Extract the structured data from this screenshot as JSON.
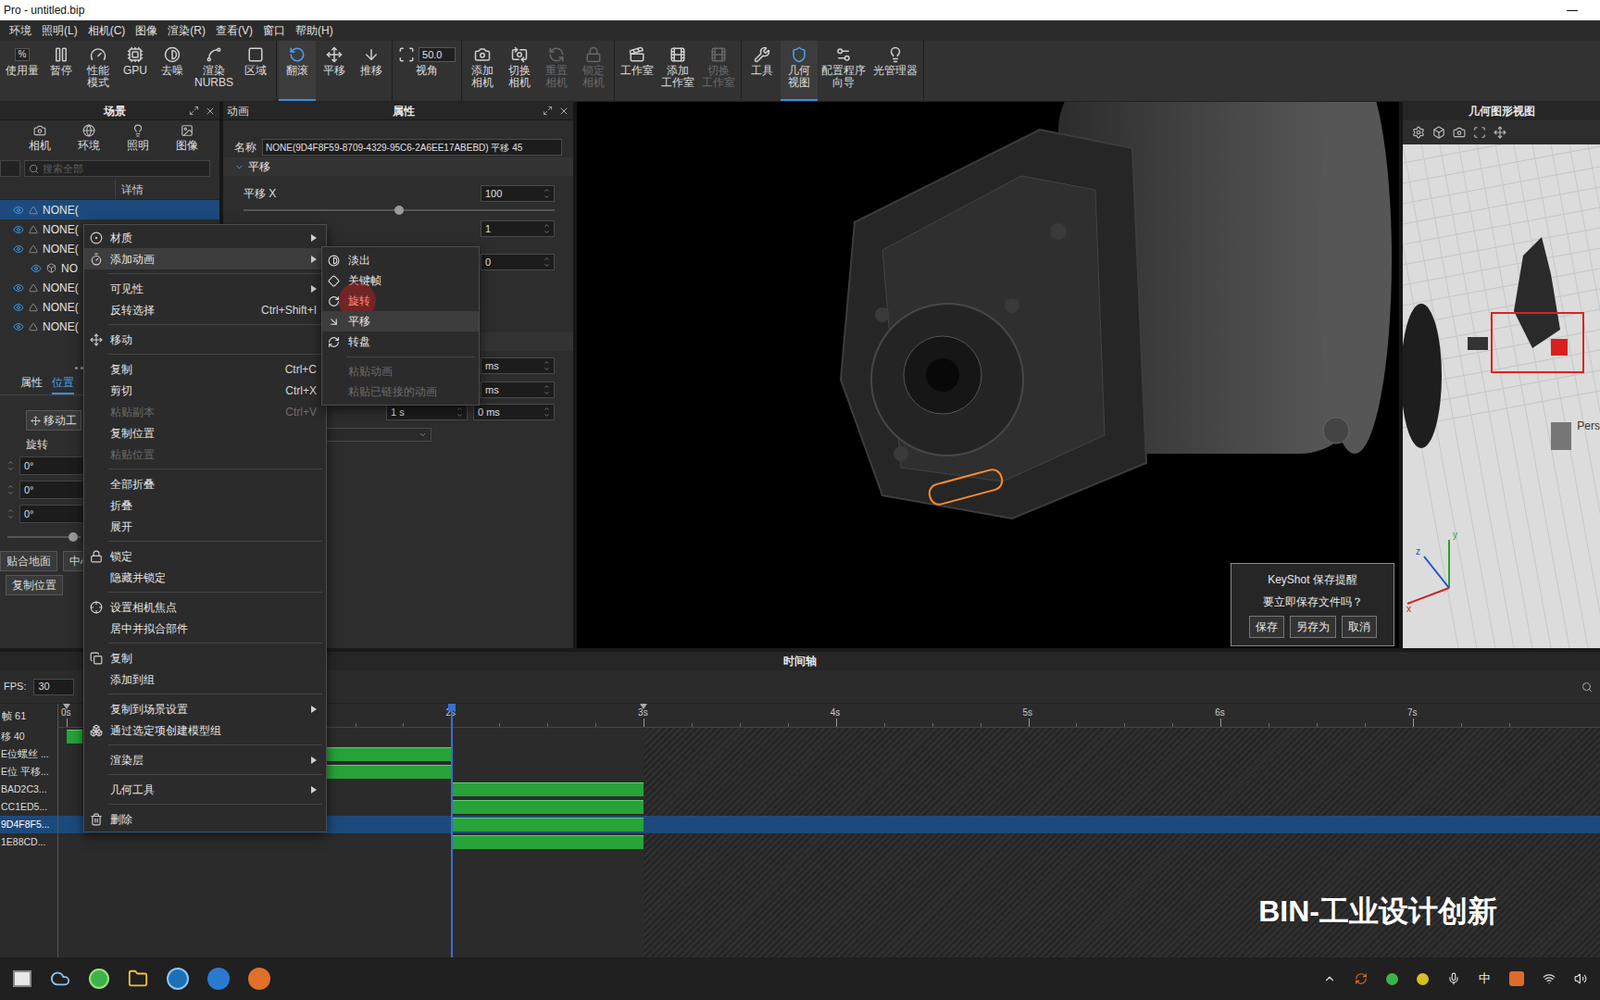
{
  "window": {
    "title": "Pro  - untitled.bip",
    "minimize": "—"
  },
  "menu_bar": [
    "环境",
    "照明(L)",
    "相机(C)",
    "图像",
    "渲染(R)",
    "查看(V)",
    "窗口",
    "帮助(H)"
  ],
  "toolbar": [
    [
      {
        "lines": [
          "使用量"
        ],
        "badge": "%",
        "selected": false,
        "disabled": false
      },
      {
        "lines": [
          "暂停"
        ],
        "selected": false,
        "disabled": false
      },
      {
        "lines": [
          "性能",
          "模式"
        ],
        "selected": false,
        "disabled": false
      },
      {
        "lines": [
          "GPU"
        ],
        "selected": false,
        "disabled": false
      },
      {
        "lines": [
          "去噪"
        ],
        "selected": false,
        "disabled": false
      },
      {
        "lines": [
          "渲染",
          "NURBS"
        ],
        "selected": false,
        "disabled": false
      },
      {
        "lines": [
          "区域"
        ],
        "selected": false,
        "disabled": false
      }
    ],
    [
      {
        "lines": [
          "翻滚"
        ],
        "selected": true,
        "disabled": false
      },
      {
        "lines": [
          "平移"
        ],
        "selected": false,
        "disabled": false
      },
      {
        "lines": [
          "推移"
        ],
        "selected": false,
        "disabled": false
      }
    ],
    [
      {
        "lines": [
          "视角"
        ],
        "field": "50.0",
        "selected": false,
        "disabled": false
      }
    ],
    [
      {
        "lines": [
          "添加",
          "相机"
        ],
        "selected": false,
        "disabled": false
      },
      {
        "lines": [
          "切换",
          "相机"
        ],
        "selected": false,
        "disabled": false
      },
      {
        "lines": [
          "重置",
          "相机"
        ],
        "selected": false,
        "disabled": true
      },
      {
        "lines": [
          "锁定",
          "相机"
        ],
        "selected": false,
        "disabled": true
      }
    ],
    [
      {
        "lines": [
          "工作室"
        ],
        "selected": false,
        "disabled": false
      },
      {
        "lines": [
          "添加",
          "工作室"
        ],
        "selected": false,
        "disabled": false
      },
      {
        "lines": [
          "切换",
          "工作室"
        ],
        "selected": false,
        "disabled": true
      }
    ],
    [
      {
        "lines": [
          "工具"
        ],
        "selected": false,
        "disabled": false
      },
      {
        "lines": [
          "几何",
          "视图"
        ],
        "selected": true,
        "disabled": false
      },
      {
        "lines": [
          "配置程序",
          "向导"
        ],
        "selected": false,
        "disabled": false
      },
      {
        "lines": [
          "光管理器"
        ],
        "selected": false,
        "disabled": false
      }
    ]
  ],
  "scene_panel": {
    "title": "场景",
    "tabs": [
      {
        "label": "相机"
      },
      {
        "label": "环境"
      },
      {
        "label": "照明"
      },
      {
        "label": "图像"
      }
    ],
    "search_placeholder": "搜索全部",
    "column": "详情",
    "tree": [
      {
        "label": "NONE(",
        "selected": true,
        "child": false
      },
      {
        "label": "NONE(",
        "selected": false,
        "child": false
      },
      {
        "label": "NONE(",
        "selected": false,
        "child": false
      },
      {
        "label": "NO",
        "selected": false,
        "child": true
      },
      {
        "label": "NONE(",
        "selected": false,
        "child": false
      },
      {
        "label": "NONE(",
        "selected": false,
        "child": false
      },
      {
        "label": "NONE(",
        "selected": false,
        "child": false
      }
    ],
    "bottom_tabs": [
      {
        "label": "属性",
        "selected": false
      },
      {
        "label": "位置",
        "selected": true
      }
    ],
    "move_tool": "移动工",
    "rotate_label": "旋转",
    "rotation": [
      "0°",
      "0°",
      "0°"
    ],
    "slider_level": 0.9,
    "buttons_row1": [
      "贴合地面",
      "中心"
    ],
    "buttons_row2": [
      "复制位置"
    ]
  },
  "properties_panel": {
    "tab_left": "动画",
    "title": "属性",
    "name_label": "名称",
    "name_value": "NONE(9D4F8F59-8709-4329-95C6-2A6EE17ABEBD) 平移 45",
    "section": "平移",
    "translate_x_label": "平移 X",
    "translate_x": "100",
    "slider_level": 0.5,
    "translate_y": "1",
    "translate_z": "0",
    "time_fields": [
      "ms",
      "ms"
    ],
    "duration": "1 s",
    "offset": "0 ms"
  },
  "save_dialog": {
    "title": "KeyShot 保存提醒",
    "message": "要立即保存文件吗？",
    "buttons": [
      "保存",
      "另存为",
      "取消"
    ]
  },
  "geometry_view": {
    "title": "几何图形视图",
    "camera_label": "Pers",
    "axes": [
      "z",
      "y",
      "x"
    ]
  },
  "context_menu": [
    {
      "label": "材质",
      "shortcut": "",
      "submenu": true,
      "disabled": false,
      "selected": false,
      "separator_after": false
    },
    {
      "label": "添加动画",
      "shortcut": "",
      "submenu": true,
      "disabled": false,
      "selected": true,
      "separator_after": true
    },
    {
      "label": "可见性",
      "shortcut": "",
      "submenu": true,
      "disabled": false,
      "selected": false,
      "separator_after": false
    },
    {
      "label": "反转选择",
      "shortcut": "Ctrl+Shift+I",
      "submenu": false,
      "disabled": false,
      "selected": false,
      "separator_after": true
    },
    {
      "label": "移动",
      "shortcut": "",
      "submenu": false,
      "disabled": false,
      "selected": false,
      "separator_after": true
    },
    {
      "label": "复制",
      "shortcut": "Ctrl+C",
      "submenu": false,
      "disabled": false,
      "selected": false,
      "separator_after": false
    },
    {
      "label": "剪切",
      "shortcut": "Ctrl+X",
      "submenu": false,
      "disabled": false,
      "selected": false,
      "separator_after": false
    },
    {
      "label": "粘贴副本",
      "shortcut": "Ctrl+V",
      "submenu": false,
      "disabled": true,
      "selected": false,
      "separator_after": false
    },
    {
      "label": "复制位置",
      "shortcut": "",
      "submenu": false,
      "disabled": false,
      "selected": false,
      "separator_after": false
    },
    {
      "label": "粘贴位置",
      "shortcut": "",
      "submenu": false,
      "disabled": true,
      "selected": false,
      "separator_after": true
    },
    {
      "label": "全部折叠",
      "shortcut": "",
      "submenu": false,
      "disabled": false,
      "selected": false,
      "separator_after": false
    },
    {
      "label": "折叠",
      "shortcut": "",
      "submenu": false,
      "disabled": false,
      "selected": false,
      "separator_after": false
    },
    {
      "label": "展开",
      "shortcut": "",
      "submenu": false,
      "disabled": false,
      "selected": false,
      "separator_after": true
    },
    {
      "label": "锁定",
      "shortcut": "",
      "submenu": false,
      "disabled": false,
      "selected": false,
      "separator_after": false
    },
    {
      "label": "隐藏并锁定",
      "shortcut": "",
      "submenu": false,
      "disabled": false,
      "selected": false,
      "separator_after": true
    },
    {
      "label": "设置相机焦点",
      "shortcut": "",
      "submenu": false,
      "disabled": false,
      "selected": false,
      "separator_after": false
    },
    {
      "label": "居中并拟合部件",
      "shortcut": "",
      "submenu": false,
      "disabled": false,
      "selected": false,
      "separator_after": true
    },
    {
      "label": "复制",
      "shortcut": "",
      "submenu": false,
      "disabled": false,
      "selected": false,
      "separator_after": false
    },
    {
      "label": "添加到组",
      "shortcut": "",
      "submenu": false,
      "disabled": false,
      "selected": false,
      "separator_after": true
    },
    {
      "label": "复制到场景设置",
      "shortcut": "",
      "submenu": true,
      "disabled": false,
      "selected": false,
      "separator_after": false
    },
    {
      "label": "通过选定项创建模型组",
      "shortcut": "",
      "submenu": false,
      "disabled": false,
      "selected": false,
      "separator_after": true
    },
    {
      "label": "渲染层",
      "shortcut": "",
      "submenu": true,
      "disabled": false,
      "selected": false,
      "separator_after": true
    },
    {
      "label": "几何工具",
      "shortcut": "",
      "submenu": true,
      "disabled": false,
      "selected": false,
      "separator_after": true
    },
    {
      "label": "删除",
      "shortcut": "",
      "submenu": false,
      "disabled": false,
      "selected": false,
      "separator_after": false
    }
  ],
  "animation_submenu": [
    {
      "label": "淡出",
      "disabled": false,
      "selected": false,
      "pressed": false,
      "separator_after": false
    },
    {
      "label": "关键帧",
      "disabled": false,
      "selected": false,
      "pressed": false,
      "separator_after": false
    },
    {
      "label": "旋转",
      "disabled": false,
      "selected": false,
      "pressed": true,
      "separator_after": false
    },
    {
      "label": "平移",
      "disabled": false,
      "selected": true,
      "pressed": false,
      "separator_after": false
    },
    {
      "label": "转盘",
      "disabled": false,
      "selected": false,
      "pressed": false,
      "separator_after": true
    },
    {
      "label": "粘贴动画",
      "disabled": true,
      "selected": false,
      "pressed": false,
      "separator_after": false
    },
    {
      "label": "粘贴已链接的动画",
      "disabled": true,
      "selected": false,
      "pressed": false,
      "separator_after": false
    }
  ],
  "timeline": {
    "title": "时间轴",
    "fps_label": "FPS:",
    "fps": "30",
    "frame_label": "帧 61",
    "ticks": [
      {
        "label": "0s",
        "t": 0
      },
      {
        "label": "2s",
        "t": 2
      },
      {
        "label": "3s",
        "t": 3
      },
      {
        "label": "4s",
        "t": 4
      },
      {
        "label": "5s",
        "t": 5
      },
      {
        "label": "6s",
        "t": 6
      },
      {
        "label": "7s",
        "t": 7
      }
    ],
    "current": 2,
    "range_end": 3,
    "tracks": [
      {
        "label": "移 40",
        "start": 0,
        "end": 0.08,
        "selected": false
      },
      {
        "label": "E位螺丝 ...",
        "start": 1,
        "end": 2,
        "selected": false
      },
      {
        "label": "E位 平移...",
        "start": 1,
        "end": 2,
        "selected": false
      },
      {
        "label": "BAD2C3...",
        "start": 2,
        "end": 3,
        "selected": false
      },
      {
        "label": "CC1ED5...",
        "start": 2,
        "end": 3,
        "selected": false
      },
      {
        "label": "9D4F8F5...",
        "start": 2,
        "end": 3,
        "selected": true
      },
      {
        "label": "1E88CD...",
        "start": 2,
        "end": 3,
        "selected": false
      }
    ]
  },
  "watermark": "BIN-工业设计创新",
  "taskbar": {
    "ime": "中"
  }
}
